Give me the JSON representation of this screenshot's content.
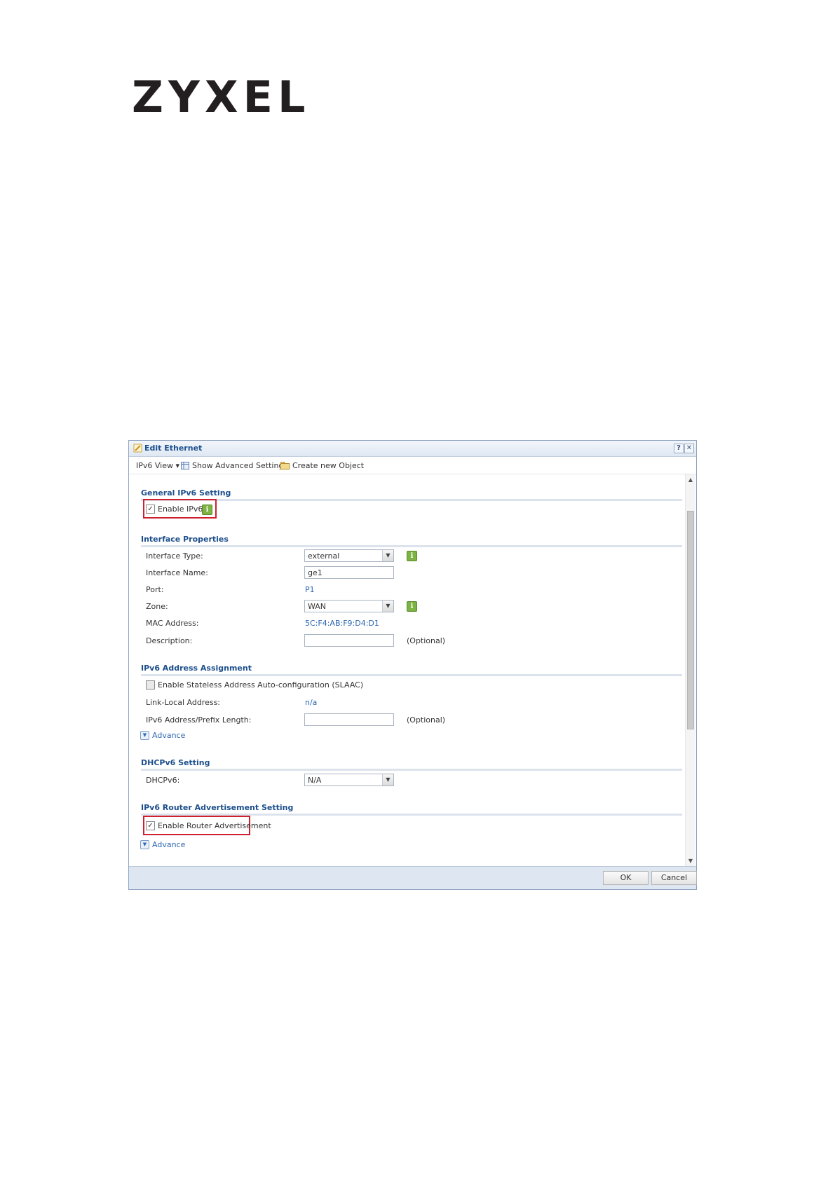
{
  "brand": {
    "logo_text": "ZYXEL"
  },
  "dialog": {
    "title": "Edit Ethernet",
    "help_label": "?",
    "close_label": "✕",
    "toolbar": {
      "ipv6_view": "IPv6 View ▾",
      "show_advanced": "Show Advanced Settings",
      "create_object": "Create new Object"
    },
    "general": {
      "header": "General IPv6 Setting",
      "enable_ipv6": {
        "label": "Enable IPv6",
        "checked": true
      }
    },
    "interface": {
      "header": "Interface Properties",
      "type_label": "Interface Type:",
      "type_value": "external",
      "name_label": "Interface Name:",
      "name_value": "ge1",
      "port_label": "Port:",
      "port_value": "P1",
      "zone_label": "Zone:",
      "zone_value": "WAN",
      "mac_label": "MAC Address:",
      "mac_value": "5C:F4:AB:F9:D4:D1",
      "desc_label": "Description:",
      "desc_value": "",
      "optional": "(Optional)"
    },
    "assignment": {
      "header": "IPv6 Address Assignment",
      "slaac_label": "Enable Stateless Address Auto-configuration (SLAAC)",
      "slaac_checked": false,
      "link_local_label": "Link-Local Address:",
      "link_local_value": "n/a",
      "prefix_label": "IPv6 Address/Prefix Length:",
      "prefix_value": "",
      "optional": "(Optional)",
      "advance": "Advance"
    },
    "dhcpv6": {
      "header": "DHCPv6 Setting",
      "label": "DHCPv6:",
      "value": "N/A"
    },
    "router_adv": {
      "header": "IPv6 Router Advertisement Setting",
      "enable_label": "Enable Router Advertisement",
      "checked": true,
      "advance": "Advance"
    },
    "footer": {
      "ok": "OK",
      "cancel": "Cancel"
    },
    "info_glyph": "i",
    "highlight_color": "#d0202e",
    "accent_color": "#1c4f8c"
  }
}
